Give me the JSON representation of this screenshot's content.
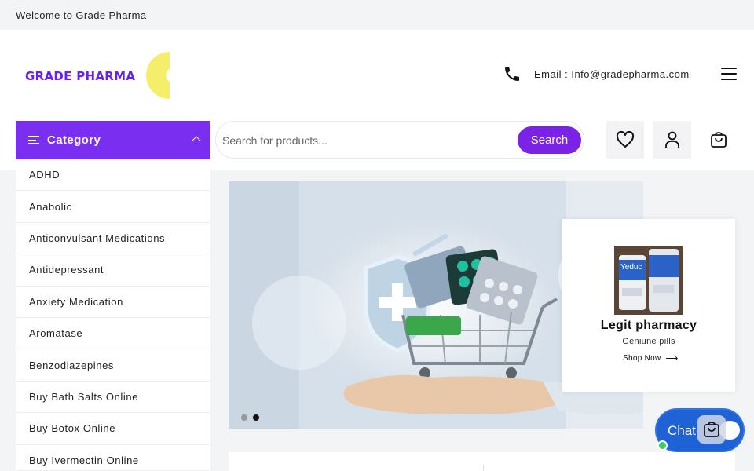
{
  "topbar": {
    "welcome": "Welcome to Grade Pharma"
  },
  "header": {
    "logo_text": "GRADE PHARMA",
    "email_label": "Email : Info@gradepharma.com"
  },
  "category": {
    "label": "Category",
    "items": [
      "ADHD",
      "Anabolic",
      "Anticonvulsant Medications",
      "Antidepressant",
      "Anxiety Medication",
      "Aromatase",
      "Benzodiazepines",
      "Buy Bath Salts Online",
      "Buy Botox Online",
      "Buy Ivermectin Online"
    ]
  },
  "search": {
    "placeholder": "Search for products...",
    "button": "Search"
  },
  "icons": {
    "wishlist": "heart-icon",
    "account": "user-icon",
    "cart": "shopping-bag-icon",
    "phone": "phone-icon",
    "menu": "hamburger-icon"
  },
  "slider": {
    "slides": 2,
    "active": 2
  },
  "promo": {
    "bottle_text": "Yeduc",
    "title": "Legit pharmacy",
    "subtitle": "Geniune pills",
    "cta": "Shop Now"
  },
  "chat": {
    "label": "Chat"
  },
  "colors": {
    "brand": "#7a2ef0",
    "search_button": "#7a22e6",
    "logo_c": "#f5ee6a",
    "chat": "#1f62d6",
    "online": "#3ccc5a"
  }
}
